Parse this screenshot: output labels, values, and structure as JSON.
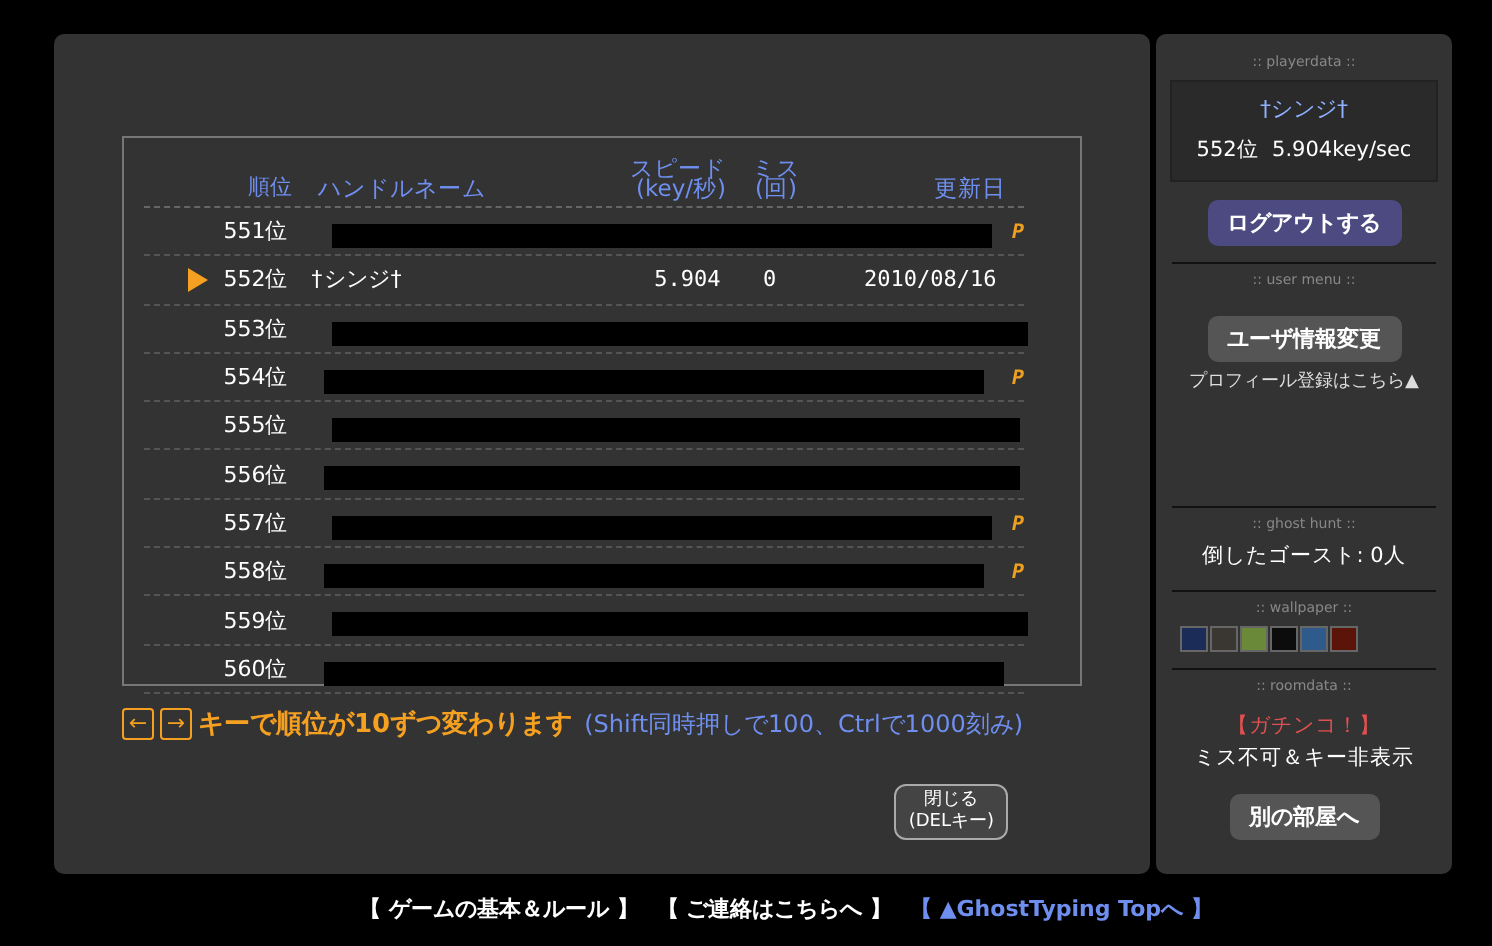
{
  "table": {
    "columns": [
      "順位",
      "ハンドルネーム",
      "スピード\n(key/秒)",
      "ミス\n(回)",
      "更新日"
    ],
    "rows": [
      {
        "rank": "551位",
        "redacted": true,
        "mark": "P",
        "selected": false
      },
      {
        "rank": "552位",
        "name": "†シンジ†",
        "speed": "5.904",
        "miss": "0",
        "date": "2010/08/16",
        "redacted": false,
        "selected": true
      },
      {
        "rank": "553位",
        "redacted": true,
        "selected": false
      },
      {
        "rank": "554位",
        "redacted": true,
        "mark": "P",
        "selected": false
      },
      {
        "rank": "555位",
        "redacted": true,
        "selected": false
      },
      {
        "rank": "556位",
        "redacted": true,
        "selected": false
      },
      {
        "rank": "557位",
        "redacted": true,
        "mark": "P",
        "selected": false
      },
      {
        "rank": "558位",
        "redacted": true,
        "mark": "P",
        "selected": false
      },
      {
        "rank": "559位",
        "redacted": true,
        "selected": false
      },
      {
        "rank": "560位",
        "redacted": true,
        "selected": false
      }
    ]
  },
  "hint": {
    "keys": [
      "←",
      "→"
    ],
    "main": "キーで順位が10ずつ変わります",
    "sub": "(Shift同時押しで100、Ctrlで1000刻み)"
  },
  "close_button": "閉じる\n(DELキー)",
  "sidebar": {
    "playerdata": {
      "heading": ":: playerdata ::",
      "name": "†シンジ†",
      "stats": "552位  5.904key/sec",
      "button": "ログアウトする"
    },
    "user_menu": {
      "heading": ":: user menu ::",
      "button": "ユーザ情報変更",
      "link": "プロフィール登録はこちら▲"
    },
    "ghost_hunt": {
      "heading": ":: ghost hunt ::",
      "text": "倒したゴースト: 0人"
    },
    "wallpaper": {
      "heading": ":: wallpaper ::",
      "swatches": [
        {
          "color": "#1c2c58"
        },
        {
          "color": "#3a3632"
        },
        {
          "color": "#6a8a3a"
        },
        {
          "color": "#0c0c0c"
        },
        {
          "color": "#2f5a8c"
        },
        {
          "color": "#5a1408"
        }
      ]
    },
    "roomdata": {
      "heading": ":: roomdata ::",
      "mode": "【ガチンコ！】",
      "rule": "ミス不可＆キー非表示",
      "button": "別の部屋へ"
    }
  },
  "footer_links": [
    {
      "text": "【 ゲームの基本＆ルール 】",
      "kind": "plain"
    },
    {
      "text": "【 ご連絡はこちらへ 】",
      "kind": "plain"
    },
    {
      "text": "【 ▲GhostTyping Topへ 】",
      "kind": "accent"
    }
  ]
}
